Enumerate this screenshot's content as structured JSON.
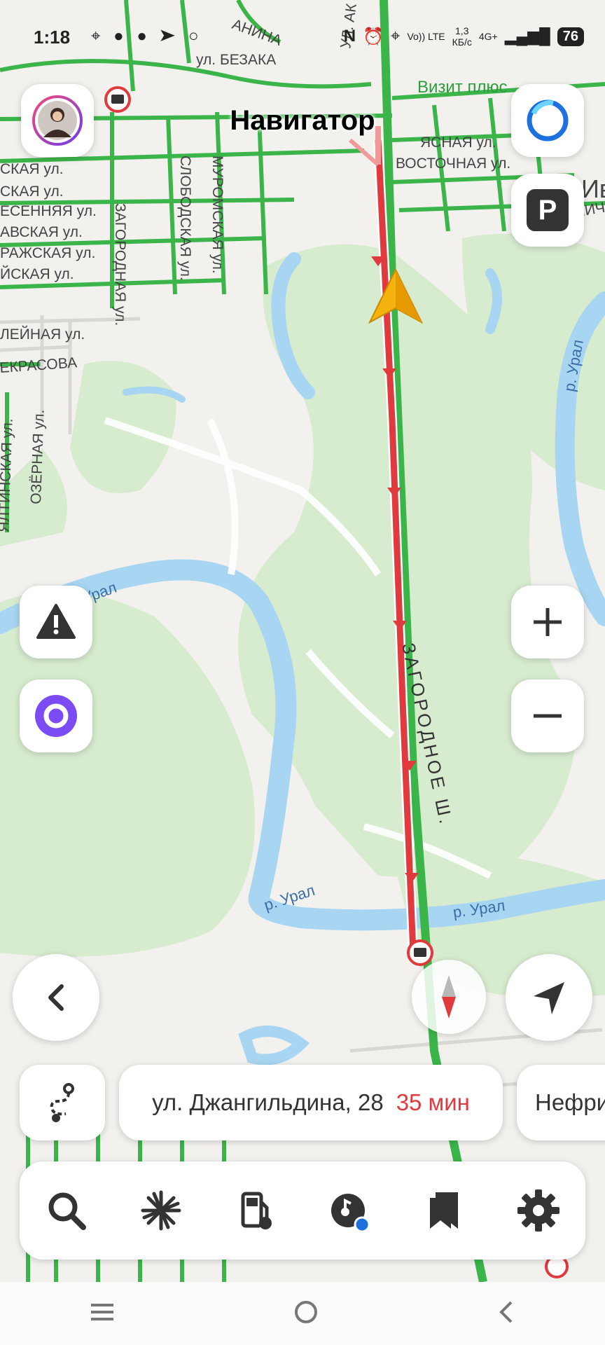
{
  "status_bar": {
    "time": "1:18",
    "network": "4G+",
    "speed": "1,3\nКБ/с",
    "volte": "Vo)) LTE",
    "battery": "76"
  },
  "title": "Навигатор",
  "map": {
    "streets": {
      "bezaka": "ул. БЕЗАКА",
      "vizit": "Визит плюс",
      "yasnaya": "ЯСНАЯ ул.",
      "vostochnaya": "ВОСТОЧНАЯ ул.",
      "zagorodnaya": "ЗАГОРОДНАЯ ул.",
      "slobodskaya": "СЛОБОДСКАЯ ул.",
      "muromskaya": "МУРОМСКАЯ ул.",
      "iskaya1": "СКАЯ ул.",
      "iskaya2": "СКАЯ ул.",
      "vesennyaya": "ЕСЕННЯЯ ул.",
      "vskaya": "АВСКАЯ ул.",
      "razhskaya": "РАЖСКАЯ ул.",
      "yskaya": "ЙСКАЯ ул.",
      "leynaya": "ЛЕЙНАЯ ул.",
      "nekrasova": "ЕКРАСОВА",
      "ozernaya": "ОЗЁРНАЯ ул.",
      "yaltinskaya": "ЯЛТИНСКАЯ ул.",
      "zagorodnoe": "ЗАГОРОДНОЕ Ш.",
      "ural1": "р. Урал",
      "ural2": "р. Урал",
      "ural3": "р. Урал",
      "ural4": "р. Урал",
      "ul_ak": "УЛ. АК",
      "anina": "АНИНА",
      "iv": "Ив",
      "bolnichn": "БОЛЬНИЧНА"
    }
  },
  "route": {
    "destination": "ул. Джангильдина, 28",
    "eta": "35 мин",
    "next_option": "Нефрит"
  },
  "bottom_nav": [
    {
      "name": "search-icon"
    },
    {
      "name": "discover-icon"
    },
    {
      "name": "gas-station-icon"
    },
    {
      "name": "music-icon"
    },
    {
      "name": "bookmarks-icon"
    },
    {
      "name": "settings-icon"
    }
  ],
  "colors": {
    "route": "#e0393e",
    "traffic_green": "#3bb54a",
    "river": "#a8d5f2",
    "park": "#d7ebcf",
    "alice": "#6c3ce9",
    "arrow": "#f6b20f"
  }
}
